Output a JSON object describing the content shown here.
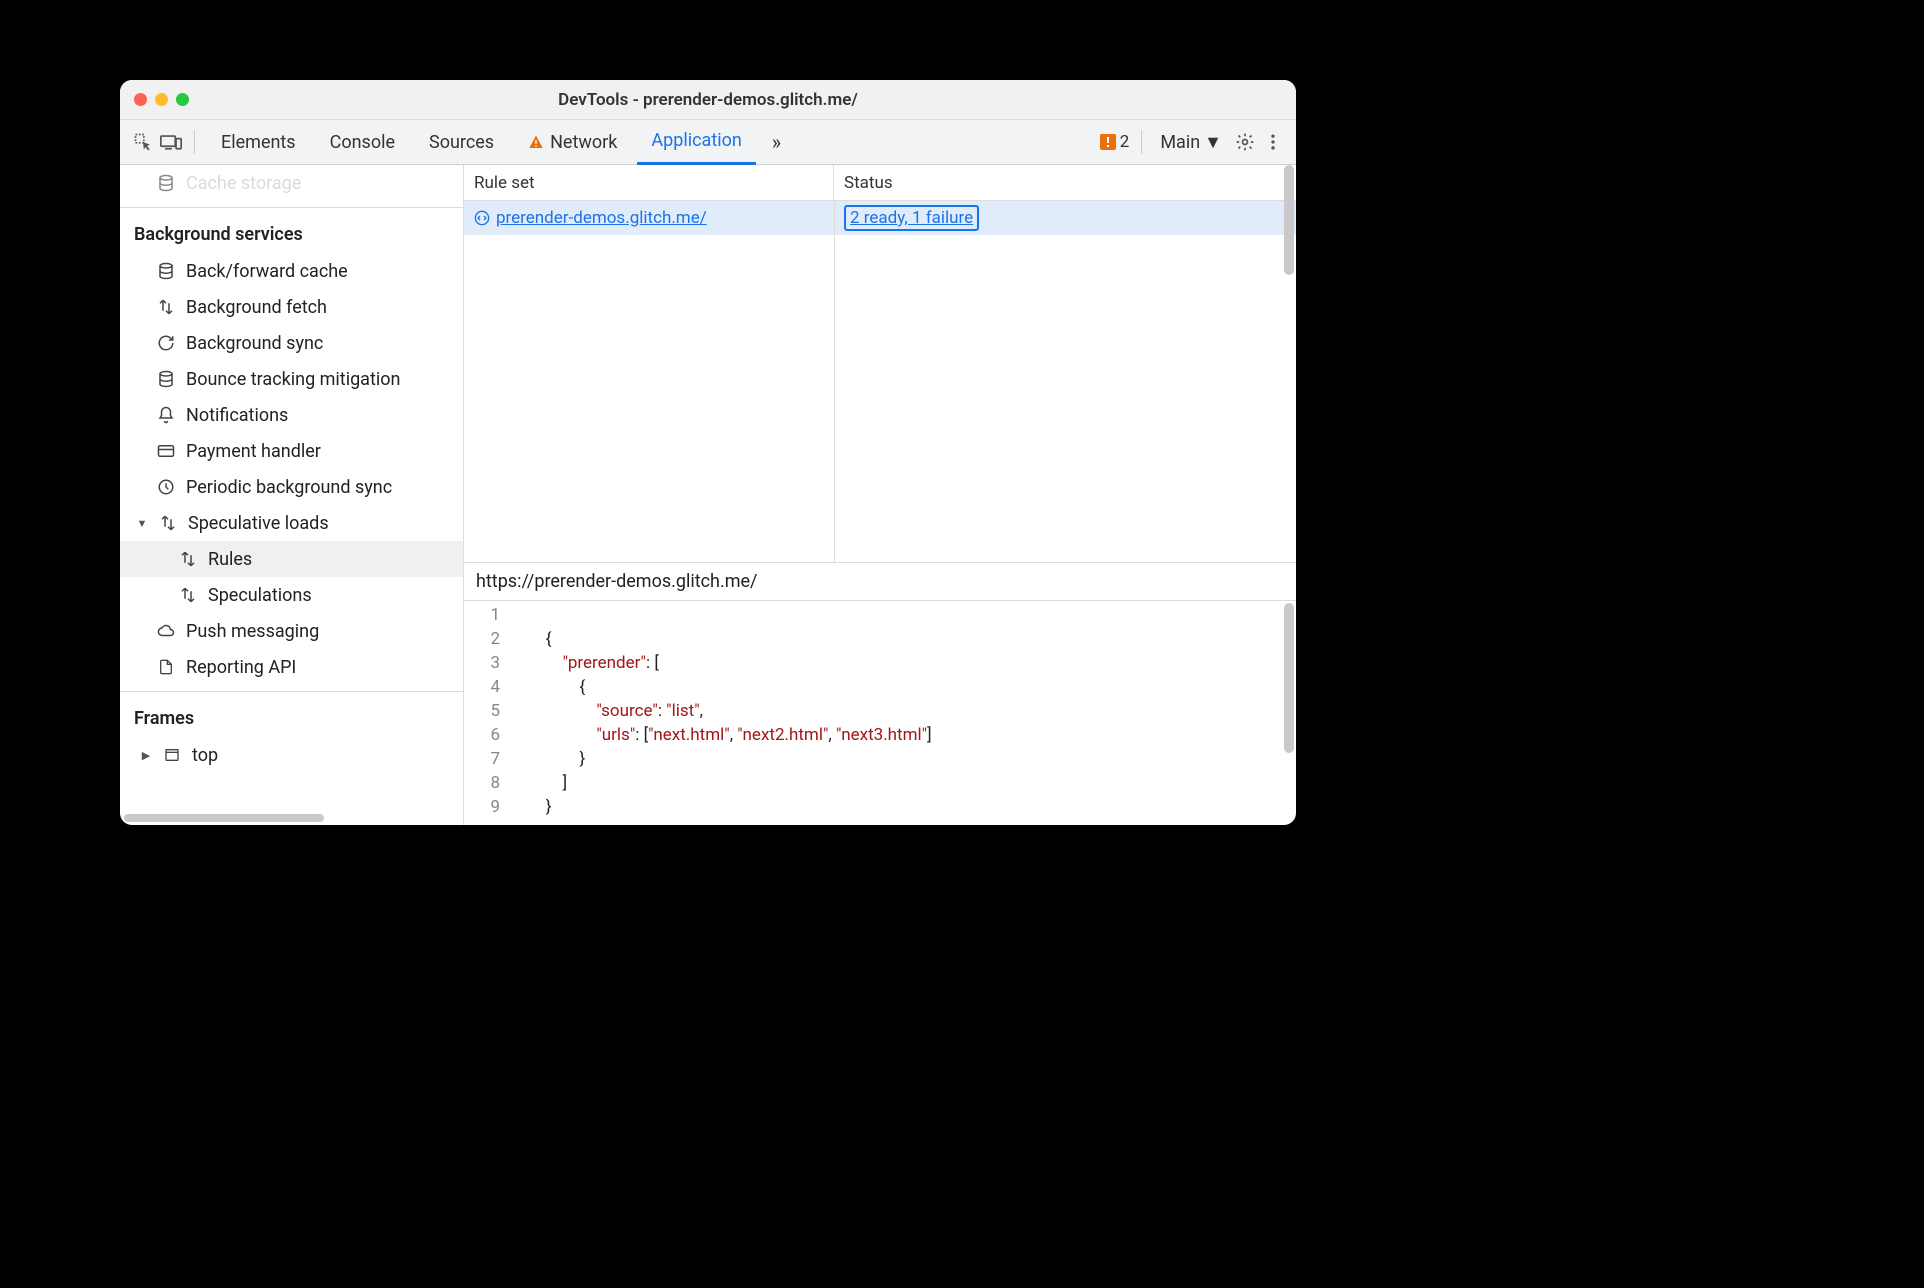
{
  "window": {
    "title": "DevTools - prerender-demos.glitch.me/"
  },
  "toolbar": {
    "tabs": {
      "elements": "Elements",
      "console": "Console",
      "sources": "Sources",
      "network": "Network",
      "application": "Application"
    },
    "error_count": "2",
    "context": "Main"
  },
  "sidebar": {
    "truncated_top": "Cache storage",
    "background_services": {
      "title": "Background services",
      "items": {
        "bfcache": "Back/forward cache",
        "bg_fetch": "Background fetch",
        "bg_sync": "Background sync",
        "bounce": "Bounce tracking mitigation",
        "notifications": "Notifications",
        "payment": "Payment handler",
        "periodic": "Periodic background sync",
        "speculative": "Speculative loads",
        "rules": "Rules",
        "speculations": "Speculations",
        "push": "Push messaging",
        "reporting": "Reporting API"
      }
    },
    "frames": {
      "title": "Frames",
      "top": "top"
    }
  },
  "grid": {
    "headers": {
      "ruleset": "Rule set",
      "status": "Status"
    },
    "row": {
      "ruleset": " prerender-demos.glitch.me/",
      "status": "2 ready, 1 failure"
    }
  },
  "detail": {
    "url": "https://prerender-demos.glitch.me/",
    "code_lines": [
      "",
      "        {",
      "            \"prerender\": [",
      "                {",
      "                    \"source\": \"list\",",
      "                    \"urls\": [\"next.html\", \"next2.html\", \"next3.html\"]",
      "                }",
      "            ]",
      "        }"
    ]
  }
}
